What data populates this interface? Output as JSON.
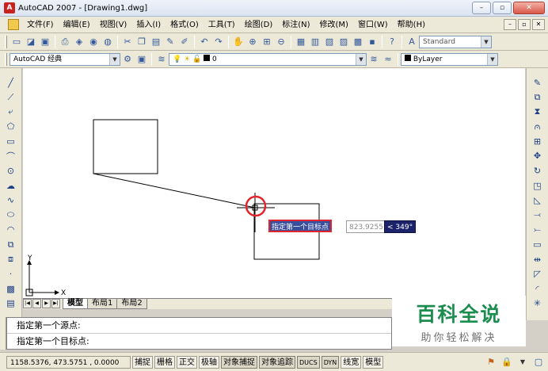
{
  "window": {
    "app_icon": "A",
    "title": "AutoCAD 2007 - [Drawing1.dwg]",
    "min_label": "–",
    "max_label": "▫",
    "close_label": "✕"
  },
  "menu": {
    "items": [
      "文件(F)",
      "编辑(E)",
      "视图(V)",
      "插入(I)",
      "格式(O)",
      "工具(T)",
      "绘图(D)",
      "标注(N)",
      "修改(M)",
      "窗口(W)",
      "帮助(H)"
    ],
    "mdi_min": "–",
    "mdi_restore": "▫",
    "mdi_close": "✕"
  },
  "toolbar1": {
    "icons": [
      "new-icon",
      "open-icon",
      "save-icon",
      "print-icon",
      "preview-icon",
      "publish-icon",
      "plot-icon",
      "cut-icon",
      "copy-icon",
      "paste-icon",
      "match-icon",
      "brush-icon",
      "undo-icon",
      "redo-icon",
      "pan-icon",
      "zoom-realtime-icon",
      "zoom-window-icon",
      "zoom-previous-icon",
      "properties-icon",
      "design-center-icon",
      "tool-palette-icon",
      "sheet-set-icon",
      "markup-icon",
      "calculator-icon",
      "help-icon"
    ],
    "text_style_value": "Standard"
  },
  "toolbar2": {
    "workspace_value": "AutoCAD 经典",
    "layer_value": "0",
    "linetype_value": "ByLayer"
  },
  "draw_toolbar": [
    "line-icon",
    "construction-line-icon",
    "polyline-icon",
    "polygon-icon",
    "rectangle-icon",
    "arc-icon",
    "circle-icon",
    "revision-cloud-icon",
    "spline-icon",
    "ellipse-icon",
    "ellipse-arc-icon",
    "insert-block-icon",
    "make-block-icon",
    "point-icon",
    "hatch-icon",
    "region-icon"
  ],
  "modify_toolbar": [
    "erase-icon",
    "copy-object-icon",
    "mirror-icon",
    "offset-icon",
    "array-icon",
    "move-icon",
    "rotate-icon",
    "scale-icon",
    "stretch-icon",
    "trim-icon",
    "extend-icon",
    "break-icon",
    "join-icon",
    "chamfer-icon",
    "fillet-icon",
    "explode-icon"
  ],
  "tooltip": {
    "prompt": "指定第一个目标点",
    "value": "823.9255",
    "angle": "< 349°"
  },
  "ucs": {
    "x_label": "X",
    "y_label": "Y"
  },
  "tabs": {
    "nav": [
      "|◀",
      "◀",
      "▶",
      "▶|"
    ],
    "items": [
      "模型",
      "布局1",
      "布局2"
    ]
  },
  "watermark": {
    "title": "百科全说",
    "subtitle": "助你轻松解决"
  },
  "command_line": {
    "lines": [
      "指定第一个源点:",
      "指定第一个目标点:"
    ]
  },
  "status": {
    "coords": "1158.5376, 473.5751 , 0.0000",
    "buttons": [
      "捕捉",
      "栅格",
      "正交",
      "极轴",
      "对象捕捉",
      "对象追踪",
      "DUCS",
      "DYN",
      "线宽",
      "模型"
    ],
    "pressed": [
      "对象捕捉",
      "对象追踪",
      "DUCS",
      "DYN"
    ]
  },
  "colors": {
    "highlight_red": "#e0262a",
    "tooltip_blue": "#3a4f9c",
    "watermark_green": "#1c8d4e"
  }
}
